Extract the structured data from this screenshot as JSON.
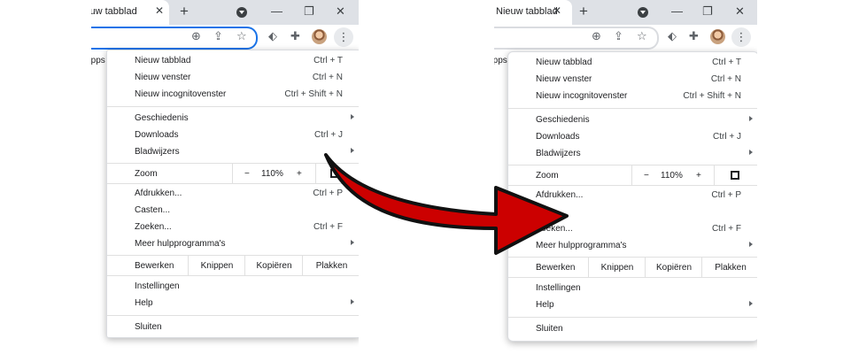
{
  "tab": {
    "title": "Nieuw tabblad",
    "close_icon": "close-icon"
  },
  "icons": {
    "new_tab": "+",
    "minimize": "—",
    "restore": "❐",
    "close": "✕",
    "zoom_in": "⊕",
    "share": "⇪",
    "star": "☆",
    "extension": "puzzle",
    "menu": "⋮"
  },
  "apps_label": "Apps",
  "menu": {
    "items": {
      "new_tab": {
        "label": "Nieuw tabblad",
        "shortcut": "Ctrl + T"
      },
      "new_window": {
        "label": "Nieuw venster",
        "shortcut": "Ctrl + N"
      },
      "incognito": {
        "label": "Nieuw incognitovenster",
        "shortcut": "Ctrl + Shift + N"
      },
      "history": {
        "label": "Geschiedenis"
      },
      "downloads": {
        "label": "Downloads",
        "shortcut": "Ctrl + J"
      },
      "bookmarks": {
        "label": "Bladwijzers"
      },
      "print": {
        "label": "Afdrukken...",
        "shortcut": "Ctrl + P"
      },
      "cast": {
        "label": "Casten..."
      },
      "find": {
        "label": "Zoeken...",
        "shortcut": "Ctrl + F"
      },
      "more_tools": {
        "label": "Meer hulpprogramma's"
      },
      "settings": {
        "label": "Instellingen"
      },
      "help": {
        "label": "Help"
      },
      "exit": {
        "label": "Sluiten"
      }
    },
    "zoom": {
      "label": "Zoom",
      "minus": "−",
      "value": "110%",
      "plus": "+"
    },
    "edit": {
      "label": "Bewerken",
      "cut": "Knippen",
      "copy": "Kopiëren",
      "paste": "Plakken"
    }
  },
  "colors": {
    "arrow_fill": "#cc0000",
    "arrow_stroke": "#111111",
    "accent": "#1a73e8"
  }
}
